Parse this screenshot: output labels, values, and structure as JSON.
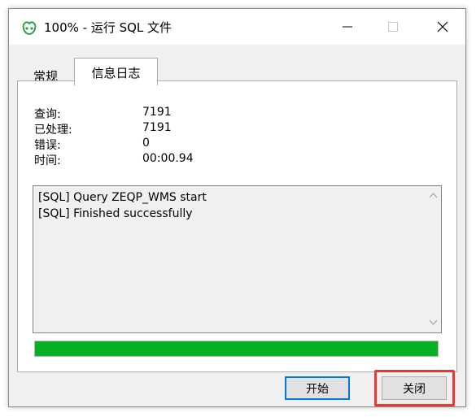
{
  "window": {
    "title": "100% - 运行 SQL 文件",
    "icon": "navicat-icon"
  },
  "tabs": [
    {
      "label": "常规",
      "active": false
    },
    {
      "label": "信息日志",
      "active": true
    }
  ],
  "stats": {
    "query_label": "查询:",
    "query_value": "7191",
    "processed_label": "已处理:",
    "processed_value": "7191",
    "errors_label": "错误:",
    "errors_value": "0",
    "time_label": "时间:",
    "time_value": "00:00.94"
  },
  "log": {
    "lines": [
      "[SQL] Query ZEQP_WMS start",
      "[SQL] Finished successfully"
    ]
  },
  "progress": {
    "percent": 100,
    "color": "#06b025"
  },
  "buttons": {
    "start_label": "开始",
    "close_label": "关闭"
  },
  "colors": {
    "accent": "#0078d7",
    "highlight": "#e53935"
  }
}
